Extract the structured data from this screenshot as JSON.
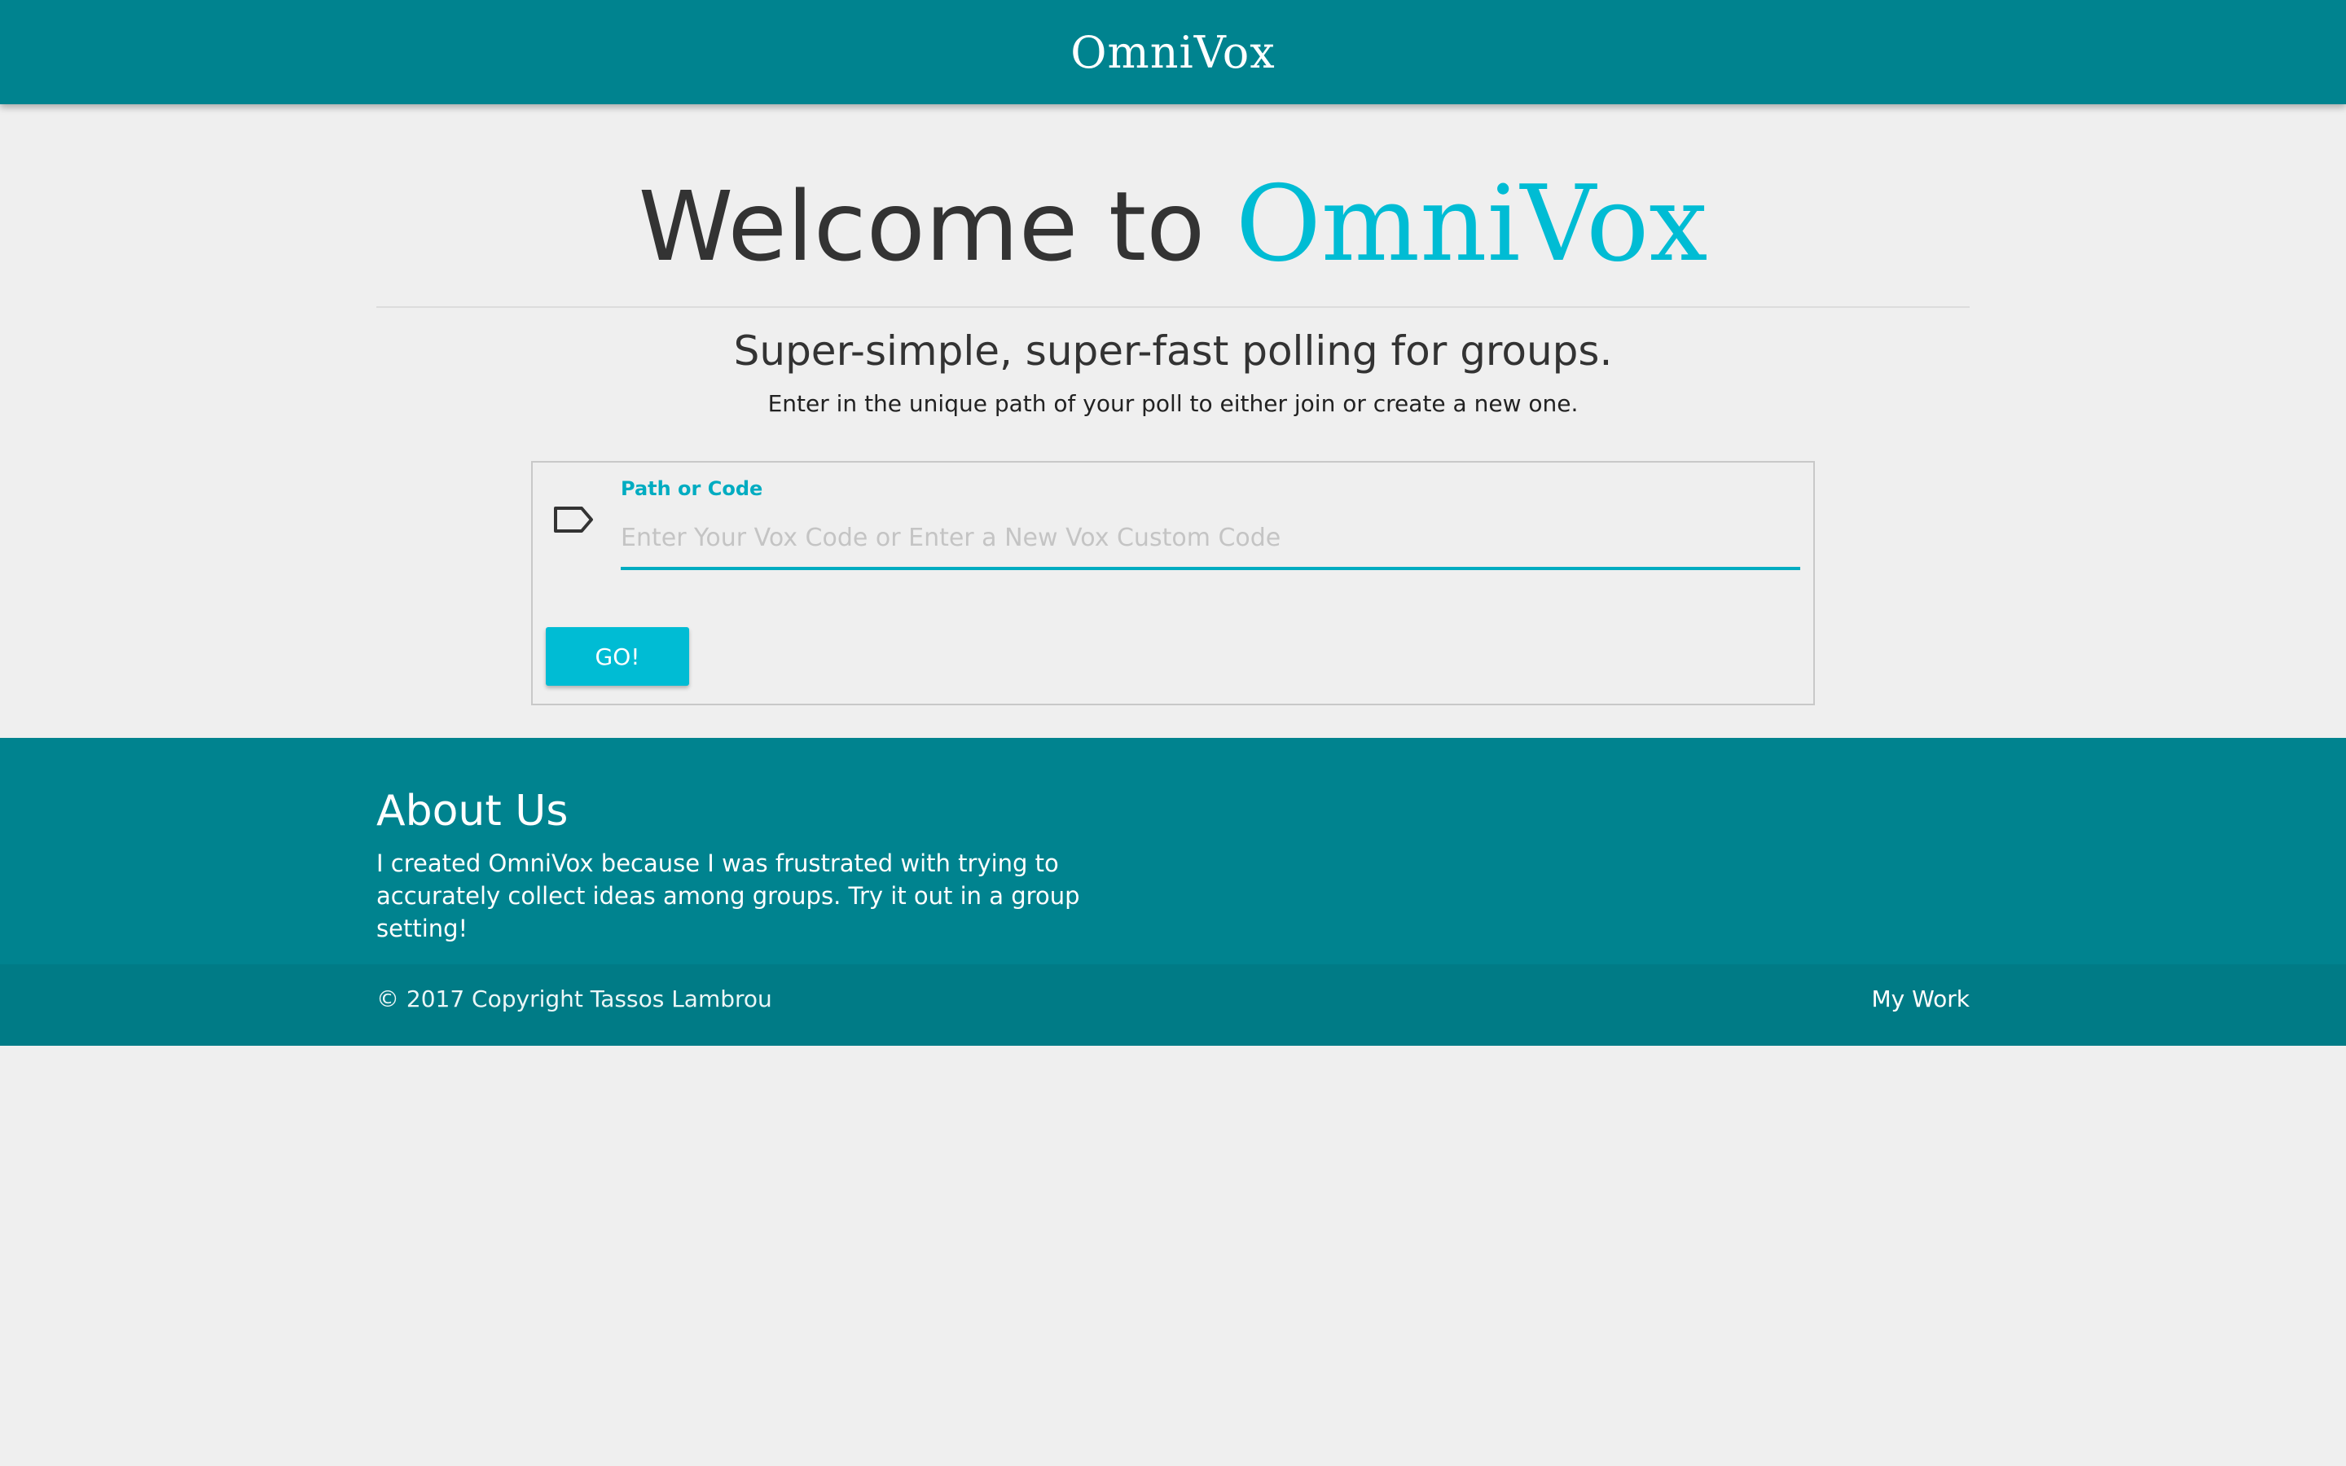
{
  "header": {
    "brand": "OmniVox"
  },
  "hero": {
    "welcome_prefix": "Welcome to",
    "welcome_brand": "OmniVox",
    "tagline": "Super-simple, super-fast polling for groups.",
    "subtext": "Enter in the unique path of your poll to either join or create a new one."
  },
  "form": {
    "icon": "tag-icon",
    "label": "Path or Code",
    "input_value": "",
    "placeholder": "Enter Your Vox Code or Enter a New Vox Custom Code",
    "go_label": "GO!"
  },
  "footer": {
    "about_title": "About Us",
    "about_text": "I created OmniVox because I was frustrated with trying to accurately collect ideas among groups. Try it out in a group setting!",
    "copyright": "© 2017 Copyright Tassos Lambrou",
    "my_work_link": "My Work"
  },
  "colors": {
    "primary": "#00838f",
    "accent": "#00bcd4",
    "background": "#efefef"
  }
}
